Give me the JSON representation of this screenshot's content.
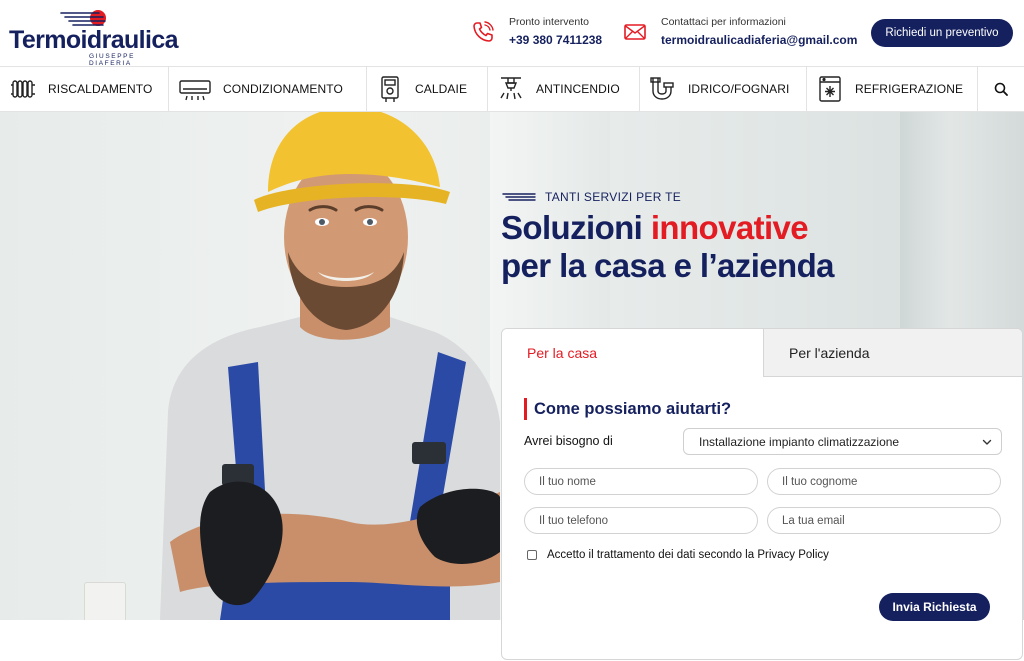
{
  "brand": {
    "name": "Termoidraulica",
    "subtitle": "GIUSEPPE DIAFERIA",
    "primary_color": "#15205e",
    "accent_color": "#e31b23"
  },
  "header": {
    "phone": {
      "icon": "phone-icon",
      "label": "Pronto intervento",
      "value": "+39 380 7411238"
    },
    "email": {
      "icon": "mail-icon",
      "label": "Contattaci per informazioni",
      "value": "termoidraulicadiaferia@gmail.com"
    },
    "quote_button": "Richiedi un preventivo"
  },
  "categories": [
    {
      "label": "RISCALDAMENTO",
      "icon": "radiator-icon"
    },
    {
      "label": "CONDIZIONAMENTO",
      "icon": "air-conditioner-icon"
    },
    {
      "label": "CALDAIE",
      "icon": "boiler-icon"
    },
    {
      "label": "ANTINCENDIO",
      "icon": "sprinkler-icon"
    },
    {
      "label": "IDRICO/FOGNARI",
      "icon": "pipe-icon"
    },
    {
      "label": "REFRIGERAZIONE",
      "icon": "refrigerator-icon"
    }
  ],
  "hero": {
    "kicker": "TANTI SERVIZI PER TE",
    "headline_part1": "Soluzioni ",
    "headline_accent": "innovative",
    "headline_line2": "per la casa e l’azienda"
  },
  "form": {
    "tabs": [
      {
        "label": "Per la casa",
        "active": true
      },
      {
        "label": "Per l'azienda",
        "active": false
      }
    ],
    "title": "Come possiamo aiutarti?",
    "need_label": "Avrei bisogno di",
    "need_value": "Installazione impianto climatizzazione",
    "fields": {
      "first_name": "Il tuo nome",
      "last_name": "Il tuo cognome",
      "phone": "Il tuo telefono",
      "email": "La tua email"
    },
    "consent": "Accetto il trattamento dei dati secondo la Privacy Policy",
    "consent_checked": false,
    "submit": "Invia Richiesta"
  }
}
